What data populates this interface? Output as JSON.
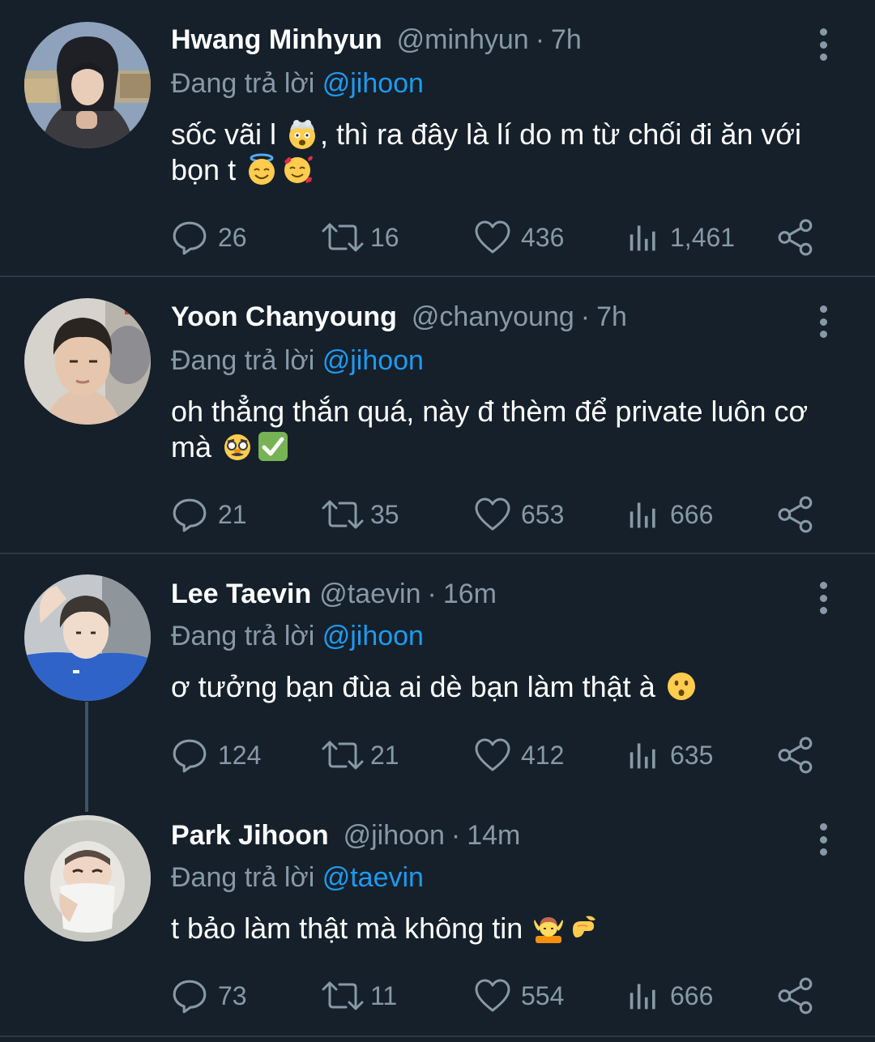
{
  "colors": {
    "background": "#15202b",
    "muted": "#8899a6",
    "link": "#1d9bf0",
    "divider": "#2c3845"
  },
  "tweets": [
    {
      "name": "Hwang Minhyun",
      "handle": "@minhyun",
      "dot": "·",
      "time": "7h",
      "replying_prefix": "Đang trả lời ",
      "replying_to": "@jihoon",
      "text_a": "sốc vãi l ",
      "text_b": ", thì ra đây là lí do m từ chối đi ăn với bọn t ",
      "emojis": [
        "exploding-head",
        "smiling-halo",
        "smiling-hearts"
      ],
      "replies": "26",
      "retweets": "16",
      "likes": "436",
      "views": "1,461"
    },
    {
      "name": "Yoon Chanyoung",
      "handle": "@chanyoung",
      "dot": "·",
      "time": "7h",
      "replying_prefix": "Đang trả lời ",
      "replying_to": "@jihoon",
      "text_a": "oh thẳng thắn quá, này đ thèm để private luôn cơ mà ",
      "emojis": [
        "disguised-face",
        "check-mark-button"
      ],
      "replies": "21",
      "retweets": "35",
      "likes": "653",
      "views": "666"
    },
    {
      "name": "Lee Taevin",
      "handle": "@taevin",
      "dot": "·",
      "time": "16m",
      "replying_prefix": "Đang trả lời ",
      "replying_to": "@jihoon",
      "text_a": "ơ tưởng bạn đùa ai dè bạn làm thật à ",
      "emojis": [
        "hushed-face"
      ],
      "replies": "124",
      "retweets": "21",
      "likes": "412",
      "views": "635"
    },
    {
      "name": "Park Jihoon",
      "handle": "@jihoon",
      "dot": "·",
      "time": "14m",
      "replying_prefix": "Đang trả lời ",
      "replying_to": "@taevin",
      "text_a": "t bảo làm thật mà không tin ",
      "emojis": [
        "person-getting-massage",
        "pinching-hand"
      ],
      "replies": "73",
      "retweets": "11",
      "likes": "554",
      "views": "666"
    }
  ]
}
